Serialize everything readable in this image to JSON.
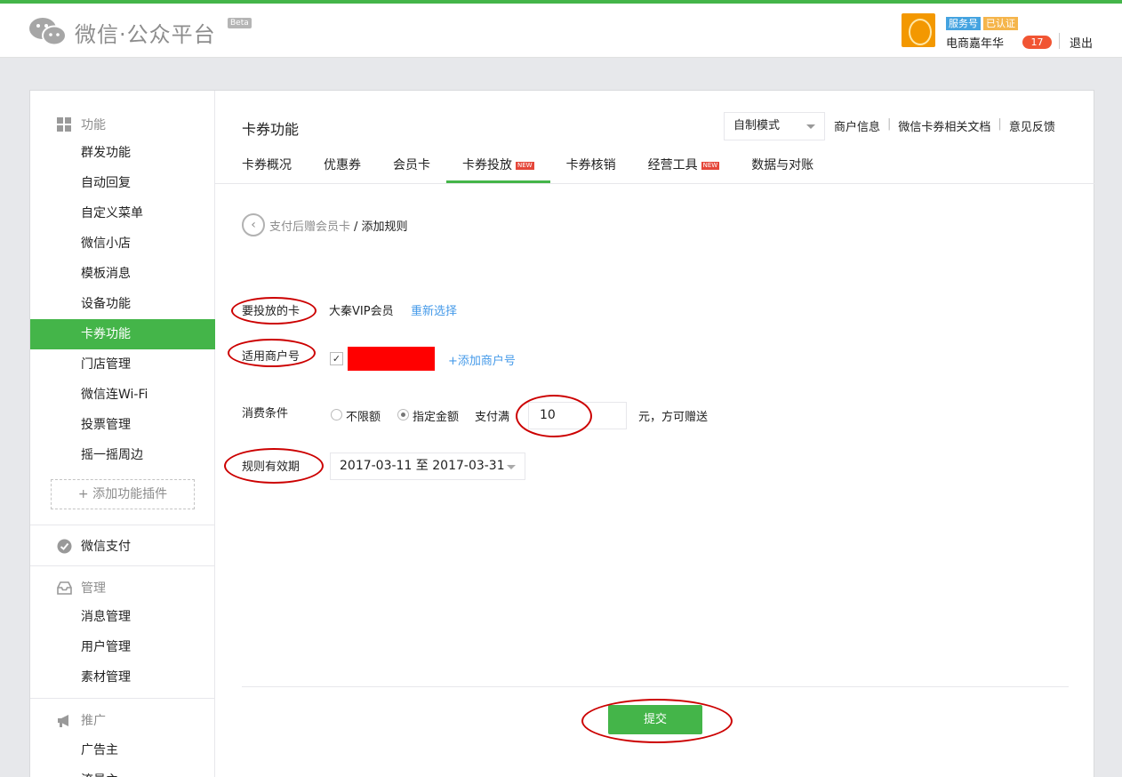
{
  "header": {
    "logo_text": "微信·公众平台",
    "beta": "Beta",
    "badge_service": "服务号",
    "badge_verified": "已认证",
    "account_name": "电商嘉年华",
    "notice_count": "17",
    "logout": "退出"
  },
  "sidebar": {
    "group_function": "功能",
    "items": [
      "群发功能",
      "自动回复",
      "自定义菜单",
      "微信小店",
      "模板消息",
      "设备功能",
      "卡券功能",
      "门店管理",
      "微信连Wi-Fi",
      "投票管理",
      "摇一摇周边"
    ],
    "add_plugin": "+ 添加功能插件",
    "wechat_pay": "微信支付",
    "group_manage": "管理",
    "manage_items": [
      "消息管理",
      "用户管理",
      "素材管理"
    ],
    "group_promote": "推广",
    "promote_items": [
      "广告主",
      "流量主"
    ]
  },
  "main": {
    "title": "卡券功能",
    "mode_select": "自制模式",
    "top_links": [
      "商户信息",
      "微信卡券相关文档",
      "意见反馈"
    ],
    "tabs": [
      "卡券概况",
      "优惠券",
      "会员卡",
      "卡券投放",
      "卡券核销",
      "经营工具",
      "数据与对账"
    ],
    "new_badge": "NEW",
    "breadcrumb_prev": "支付后赠会员卡",
    "breadcrumb_current": "/ 添加规则",
    "form": {
      "card_label": "要投放的卡",
      "card_value": "大秦VIP会员",
      "reselect": "重新选择",
      "merchant_label": "适用商户号",
      "add_merchant": "+添加商户号",
      "condition_label": "消费条件",
      "option_unlimited": "不限额",
      "option_amount": "指定金额",
      "pay_prefix": "支付满",
      "amount": "10",
      "pay_suffix": "元，方可赠送",
      "period_label": "规则有效期",
      "period_value": "2017-03-11 至 2017-03-31"
    },
    "submit": "提交"
  },
  "colors": {
    "accent": "#44b549",
    "link": "#459ae9",
    "highlight": "#cc0000"
  }
}
